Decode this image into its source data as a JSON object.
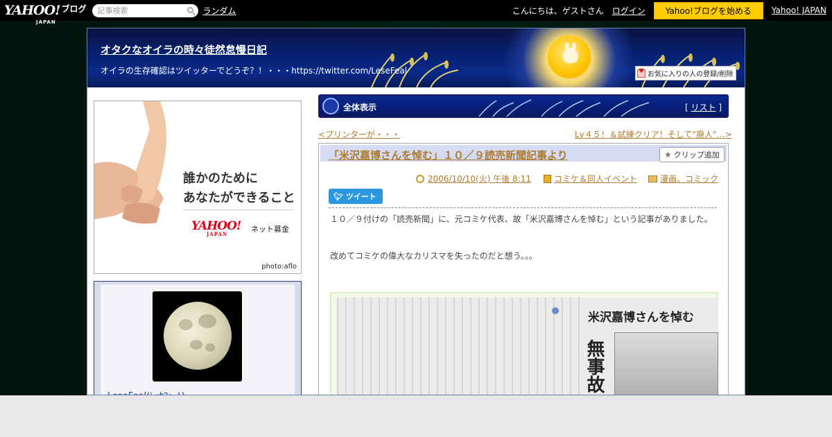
{
  "topbar": {
    "logo": "YAHOO!",
    "logo_sub": "JAPAN",
    "logo_blog": "ブログ",
    "search_placeholder": "記事検索",
    "random": "ランダム",
    "greeting": "こんにちは、ゲストさん",
    "login": "ログイン",
    "start_blog": "Yahoo!ブログを始める",
    "yahoo_japan": "Yahoo! JAPAN"
  },
  "blog": {
    "title": "オタクなオイラの時々徒然怠慢日記",
    "description": "オイラの生存確認はツイッターでどうぞ？！・・・https://twitter.com/LeseFeal",
    "favorite_button": "お気に入りの人の登録/削除"
  },
  "ad": {
    "line1": "誰かのために",
    "line2": "あなたができること",
    "logo": "YAHOO!",
    "logo_sub": "JAPAN",
    "service": "ネット募金",
    "credit": "photo:aflo"
  },
  "profile": {
    "name": "LeseFeal(ﾚｯｾﾌｪｰﾙ)"
  },
  "view_bar": {
    "label": "全体表示",
    "list_open": "[",
    "list_link": "リスト",
    "list_close": "]"
  },
  "nav": {
    "prev": "<プリンターが・・・",
    "next": "Lv４５！＆試練クリア！そして\"廃人\"…>"
  },
  "article": {
    "title": "「米沢嘉博さんを悼む」１０／９読売新聞記事より",
    "clip": "クリップ追加",
    "date": "2006/10/10(火) 午後 8:11",
    "category1": "コミケ＆同人イベント",
    "category2": "漫画、コミック",
    "tweet": "ツイート",
    "para1": "１０／９付けの「読売新聞」に、元コミケ代表、故「米沢嘉博さんを悼む」という記事がありました。",
    "para2": "改めてコミケの偉大なカリスマを失ったのだと想う。。。",
    "newspaper_headline": "米沢嘉博さんを悼む",
    "newspaper_big": "無事故"
  },
  "colors": {
    "topbar": "#000000",
    "header_blue": "#06207a",
    "link_brown": "#b07a2e",
    "start_button": "#ffcc00",
    "tweet_blue": "#2b97e0"
  }
}
